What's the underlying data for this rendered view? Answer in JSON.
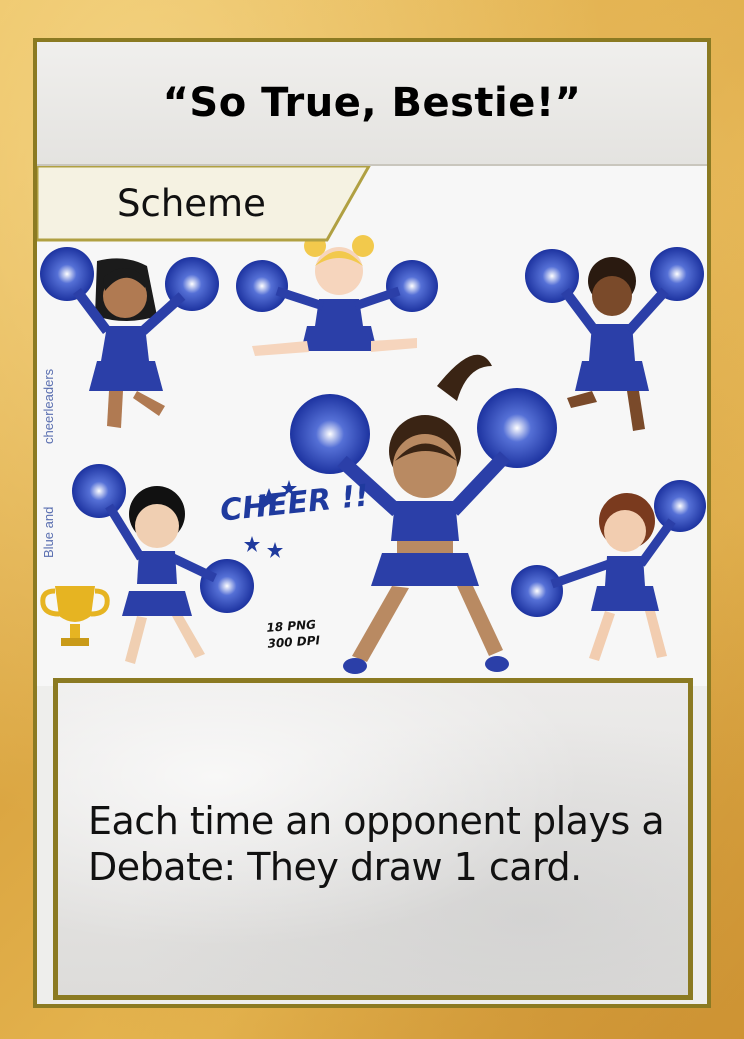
{
  "card": {
    "title": "“So True, Bestie!”",
    "type": "Scheme",
    "rules_text": "Each time an opponent plays a Debate: They draw 1 card."
  },
  "art": {
    "subject": "cheerleaders",
    "side_caption": "Blue and",
    "side_caption_2": "cheerleaders",
    "cheer_label": "CHEER !!",
    "png_count": "18 PNG",
    "dpi": "300 DPI"
  },
  "colors": {
    "frame_border": "#8b7a22",
    "background_gold": "#e2b24e",
    "uniform_blue": "#2b3fa8",
    "pompom_blue": "#2d44b8"
  }
}
